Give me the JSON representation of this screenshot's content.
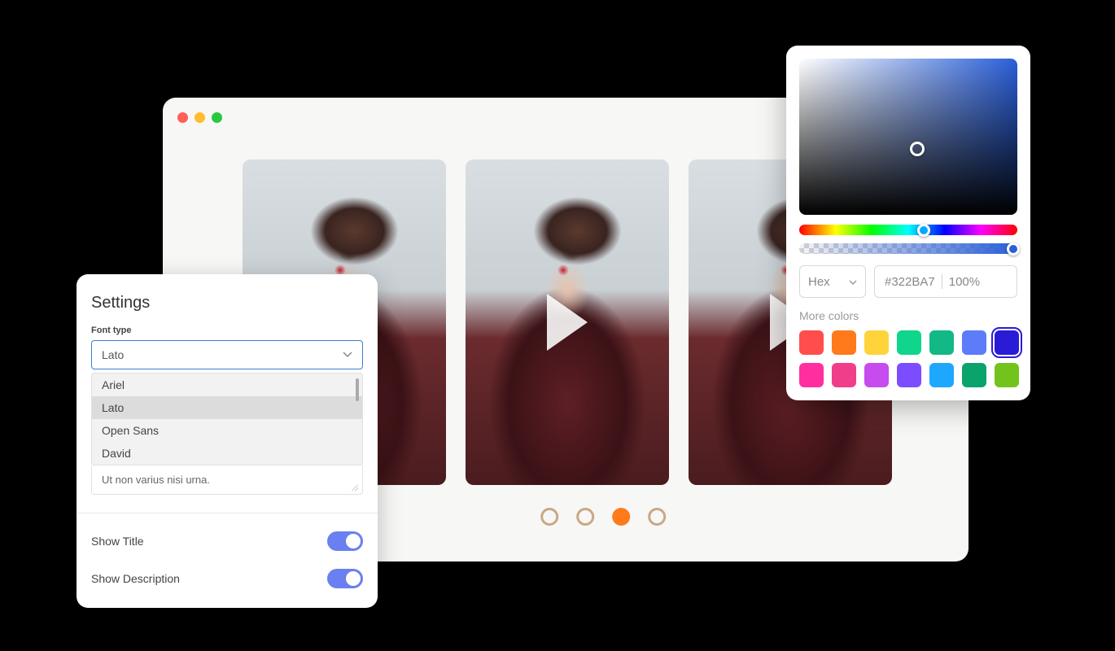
{
  "settings": {
    "title": "Settings",
    "font_type_label": "Font type",
    "selected_font": "Lato",
    "font_options": [
      "Ariel",
      "Lato",
      "Open Sans",
      "David"
    ],
    "sample_text": "Ut non varius nisi urna.",
    "show_title_label": "Show Title",
    "show_title_on": true,
    "show_description_label": "Show Description",
    "show_description_on": true
  },
  "carousel": {
    "active_dot_index": 2,
    "dot_count": 4
  },
  "color_picker": {
    "format_label": "Hex",
    "hex_value": "#322BA7",
    "opacity": "100%",
    "more_colors_label": "More colors",
    "swatches_row1": [
      "#ff4d4d",
      "#ff7a1a",
      "#ffd43b",
      "#0fd68a",
      "#12b886",
      "#5c7cfa",
      "#2a1bd6"
    ],
    "swatches_row2": [
      "#ff2fa0",
      "#f03e8b",
      "#c74cf0",
      "#7c4dff",
      "#1ea7ff",
      "#0aa36b",
      "#72c41c"
    ],
    "selected_swatch_index": 6
  }
}
